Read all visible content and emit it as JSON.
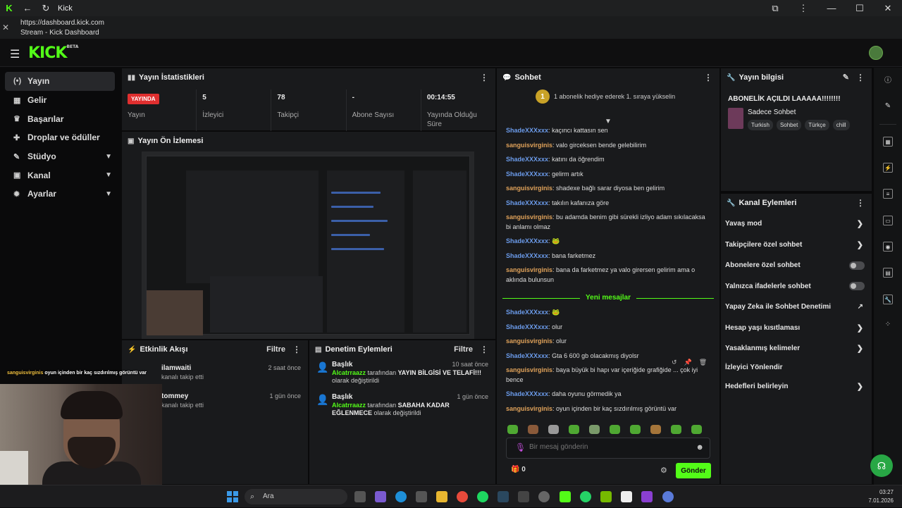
{
  "window": {
    "title": "Kick"
  },
  "url": {
    "address": "https://dashboard.kick.com",
    "page_title": "Stream - Kick Dashboard"
  },
  "logo": {
    "text": "KICK",
    "badge": "BETA"
  },
  "sidebar": {
    "items": [
      {
        "label": "Yayın",
        "icon": "broadcast-icon"
      },
      {
        "label": "Gelir",
        "icon": "revenue-icon"
      },
      {
        "label": "Başarılar",
        "icon": "trophy-icon"
      },
      {
        "label": "Droplar ve ödüller",
        "icon": "gift-icon"
      },
      {
        "label": "Stüdyo",
        "icon": "studio-icon"
      },
      {
        "label": "Kanal",
        "icon": "channel-icon"
      },
      {
        "label": "Ayarlar",
        "icon": "settings-icon"
      }
    ]
  },
  "stats": {
    "title": "Yayın İstatistikleri",
    "live_badge": "YAYINDA",
    "items": [
      {
        "value": "",
        "label": "Yayın"
      },
      {
        "value": "5",
        "label": "İzleyici"
      },
      {
        "value": "78",
        "label": "Takipçi"
      },
      {
        "value": "-",
        "label": "Abone Sayısı"
      },
      {
        "value": "00:14:55",
        "label": "Yayında Olduğu Süre"
      }
    ]
  },
  "preview": {
    "title": "Yayın Ön İzlemesi"
  },
  "activity": {
    "title": "Etkinlik Akışı",
    "filter": "Filtre",
    "items": [
      {
        "name": "ilamwaiti",
        "sub": "kanalı takip etti",
        "time": "2 saat önce"
      },
      {
        "name": "tommey",
        "sub": "kanalı takip etti",
        "time": "1 gün önce"
      }
    ]
  },
  "moderation": {
    "title": "Denetim Eylemleri",
    "filter": "Filtre",
    "items": [
      {
        "title": "Başlık",
        "time": "10 saat önce",
        "user": "Alcatrraazz",
        "mid": "tarafından",
        "value": "YAYIN BİLGİSİ VE TELAFİ!!!",
        "end": "olarak değiştirildi"
      },
      {
        "title": "Başlık",
        "time": "1 gün önce",
        "user": "Alcatrraazz",
        "mid": "tarafından",
        "value": "SABAHA KADAR EĞLENMECE",
        "end": "olarak değiştirildi"
      }
    ]
  },
  "chat": {
    "title": "Sohbet",
    "notice": "1 abonelik hediye ederek 1. sıraya yükselin",
    "notice_rank": "1",
    "messages": [
      {
        "user": "ShadeXXXxxx",
        "color": "blue",
        "text": "kaçıncı kattasın sen"
      },
      {
        "user": "sanguisvirginis",
        "color": "orange",
        "text": "valo girceksen bende gelebilirim"
      },
      {
        "user": "ShadeXXXxxx",
        "color": "blue",
        "text": "katını da öğrendim"
      },
      {
        "user": "ShadeXXXxxx",
        "color": "blue",
        "text": "gelirm artık"
      },
      {
        "user": "sanguisvirginis",
        "color": "orange",
        "text": "shadexe bağlı sarar diyosa ben gelirim"
      },
      {
        "user": "ShadeXXXxxx",
        "color": "blue",
        "text": "takılın kafanıza göre"
      },
      {
        "user": "sanguisvirginis",
        "color": "orange",
        "text": "bu adamda benim gibi sürekli izliyo adam sıkılacaksa bi anlamı olmaz"
      },
      {
        "user": "ShadeXXXxxx",
        "color": "blue",
        "text": "🐸"
      },
      {
        "user": "ShadeXXXxxx",
        "color": "blue",
        "text": "bana farketmez"
      },
      {
        "user": "sanguisvirginis",
        "color": "orange",
        "text": "bana da farketmez ya valo girersen gelirim ama o aklında bulunsun"
      }
    ],
    "new_messages_label": "Yeni mesajlar",
    "new_messages": [
      {
        "user": "ShadeXXXxxx",
        "color": "blue",
        "text": "🐸"
      },
      {
        "user": "ShadeXXXxxx",
        "color": "blue",
        "text": "olur"
      },
      {
        "user": "sanguisvirginis",
        "color": "orange",
        "text": "olur"
      },
      {
        "user": "ShadeXXXxxx",
        "color": "blue",
        "text": "Gta 6 600 gb olacakmış diyolsr"
      },
      {
        "user": "sanguisvirginis",
        "color": "orange",
        "text": "baya büyük bi hapı var içeriğide grafiğide ... çok iyi bence"
      },
      {
        "user": "ShadeXXXxxx",
        "color": "blue",
        "text": "daha oyunu görmedik ya"
      },
      {
        "user": "sanguisvirginis",
        "color": "orange",
        "text": "oyun içinden bir kaç sızdırılmış görüntü var"
      }
    ],
    "input_placeholder": "Bir mesaj gönderin",
    "points": "0",
    "send_label": "Gönder"
  },
  "stream_info": {
    "title": "Yayın bilgisi",
    "stream_title": "ABONELİK AÇILDI LAAAAA!!!!!!!!",
    "category": "Sadece Sohbet",
    "tags": [
      "Turkish",
      "Sohbet",
      "Türkçe",
      "chill"
    ]
  },
  "channel_actions": {
    "title": "Kanal Eylemleri",
    "items": [
      {
        "label": "Yavaş mod",
        "control": "chevron"
      },
      {
        "label": "Takipçilere özel sohbet",
        "control": "chevron"
      },
      {
        "label": "Abonelere özel sohbet",
        "control": "toggle"
      },
      {
        "label": "Yalnızca ifadelerle sohbet",
        "control": "toggle"
      },
      {
        "label": "Yapay Zeka ile Sohbet Denetimi",
        "control": "external"
      },
      {
        "label": "Hesap yaşı kısıtlaması",
        "control": "chevron"
      },
      {
        "label": "Yasaklanmış kelimeler",
        "control": "chevron"
      },
      {
        "label": "İzleyici Yönlendir",
        "control": "none"
      },
      {
        "label": "Hedefleri belirleyin",
        "control": "chevron"
      }
    ]
  },
  "overlay": {
    "user": "sanguisvirginis",
    "text": "oyun içinden bir kaç sızdırılmış görüntü var"
  },
  "taskbar": {
    "search": "Ara",
    "time": "03:27",
    "date": "7.01.2026"
  },
  "colors": {
    "accent": "#53fc18",
    "live": "#e02f2f",
    "user_blue": "#6b9bea",
    "user_orange": "#e0a25a"
  }
}
